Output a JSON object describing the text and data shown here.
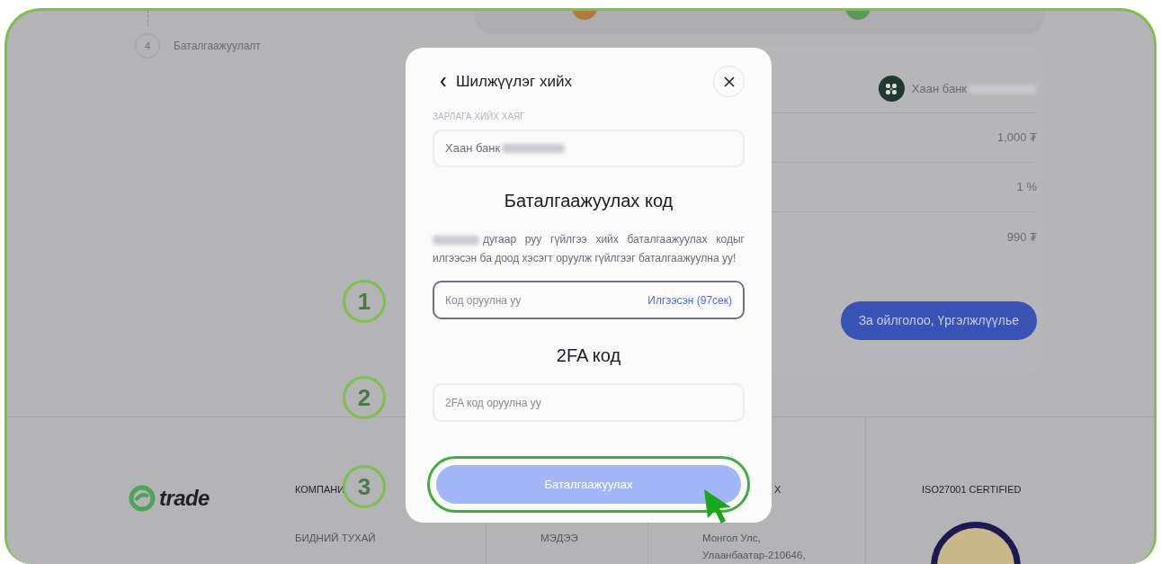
{
  "steps": [
    {
      "number": "4",
      "label": "Баталгаажуулалт"
    }
  ],
  "summary": {
    "bank": "Хаан банк",
    "rows": [
      "1,000 ₮",
      "1 %",
      "990 ₮"
    ],
    "button": "За ойлголоо, Үргэлжлүүлье"
  },
  "footer": {
    "logo": "trade",
    "columns": [
      {
        "heading": "КОМПАНИ",
        "lines": [
          "БИДНИЙ ТУХАЙ"
        ]
      },
      {
        "lines": [
          "МЭДЭЭ"
        ]
      },
      {
        "heading": "X",
        "lines": [
          "Монгол Улс,",
          "Улаанбаатар-210646,"
        ]
      },
      {
        "heading": "ISO27001 CERTIFIED"
      }
    ]
  },
  "modal": {
    "title": "Шилжүүлэг хийх",
    "address_label": "ЗАРЛАГА ХИЙХ ХАЯГ",
    "address_value": "Хаан банк",
    "code_heading": "Баталгаажуулах код",
    "message": "дугаар руу гүйлгээ хийх баталгаажуулах кодыг илгээсэн ба доод хэсэгт оруулж гүйлгээг баталгаажуулна уу!",
    "code_field": {
      "placeholder": "Код оруулна уу",
      "resend": "Илгээсэн (97сек)"
    },
    "twofa_heading": "2FA код",
    "twofa_field": {
      "placeholder": "2FA код оруулна уу"
    },
    "submit": "Баталгаажуулах"
  },
  "annotations": [
    "1",
    "2",
    "3"
  ]
}
